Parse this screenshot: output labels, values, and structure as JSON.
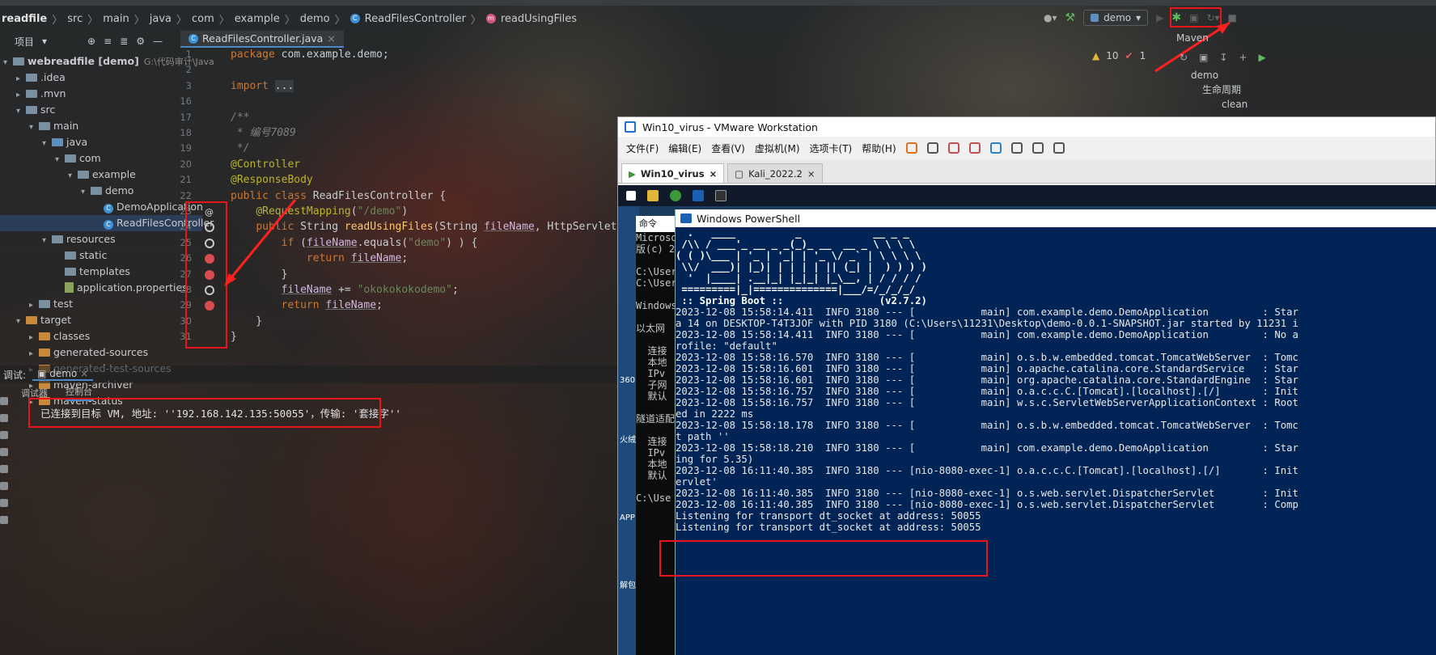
{
  "breadcrumb": [
    "readfile",
    "src",
    "main",
    "java",
    "com",
    "example",
    "demo",
    "ReadFilesController",
    "readUsingFiles"
  ],
  "project": {
    "header": "项目",
    "items": [
      {
        "label": "webreadfile [demo]",
        "extra": "G:\\代码审计\\Java",
        "indent": 0,
        "kind": "module",
        "open": true
      },
      {
        "label": ".idea",
        "indent": 1,
        "kind": "folder",
        "open": false
      },
      {
        "label": ".mvn",
        "indent": 1,
        "kind": "folder",
        "open": false
      },
      {
        "label": "src",
        "indent": 1,
        "kind": "folder",
        "open": true
      },
      {
        "label": "main",
        "indent": 2,
        "kind": "folder",
        "open": true
      },
      {
        "label": "java",
        "indent": 3,
        "kind": "bfolder",
        "open": true
      },
      {
        "label": "com",
        "indent": 4,
        "kind": "folder",
        "open": true
      },
      {
        "label": "example",
        "indent": 5,
        "kind": "folder",
        "open": true
      },
      {
        "label": "demo",
        "indent": 6,
        "kind": "folder",
        "open": true
      },
      {
        "label": "DemoApplication",
        "indent": 7,
        "kind": "class"
      },
      {
        "label": "ReadFilesController",
        "indent": 7,
        "kind": "class",
        "selected": true
      },
      {
        "label": "resources",
        "indent": 3,
        "kind": "folder",
        "open": true
      },
      {
        "label": "static",
        "indent": 4,
        "kind": "folder"
      },
      {
        "label": "templates",
        "indent": 4,
        "kind": "folder"
      },
      {
        "label": "application.properties",
        "indent": 4,
        "kind": "file"
      },
      {
        "label": "test",
        "indent": 2,
        "kind": "folder",
        "open": false
      },
      {
        "label": "target",
        "indent": 1,
        "kind": "ofolder",
        "open": true
      },
      {
        "label": "classes",
        "indent": 2,
        "kind": "ofolder",
        "open": false
      },
      {
        "label": "generated-sources",
        "indent": 2,
        "kind": "ofolder",
        "open": false
      },
      {
        "label": "generated-test-sources",
        "indent": 2,
        "kind": "ofolder",
        "open": false
      },
      {
        "label": "maven-archiver",
        "indent": 2,
        "kind": "ofolder",
        "open": false
      },
      {
        "label": "maven-status",
        "indent": 2,
        "kind": "ofolder",
        "open": false
      }
    ]
  },
  "editor": {
    "tab": "ReadFilesController.java",
    "lines": [
      {
        "n": "1",
        "html": "<span class='kw'>package</span> com.example.demo;"
      },
      {
        "n": "2",
        "html": ""
      },
      {
        "n": "3",
        "html": "<span class='kw'>import</span> <span style='background:#3a3d40'>...</span>"
      },
      {
        "n": "16",
        "html": ""
      },
      {
        "n": "17",
        "html": "<span class='cm'>/**</span>"
      },
      {
        "n": "18",
        "html": "<span class='cm'> * 编号7089</span>"
      },
      {
        "n": "19",
        "html": "<span class='cm'> */</span>"
      },
      {
        "n": "20",
        "html": "<span class='an'>@Controller</span>"
      },
      {
        "n": "21",
        "html": "<span class='an'>@ResponseBody</span>"
      },
      {
        "n": "22",
        "html": "<span class='kw'>public class</span> ReadFilesController {"
      },
      {
        "n": "23",
        "html": "    <span class='an'>@RequestMapping</span>(<span class='st'>\"/demo\"</span>)"
      },
      {
        "n": "24",
        "html": "    <span class='kw'>public</span> String <span class='fn'>readUsingFiles</span>(String <span class='vr'>fileName</span>, HttpServletRespons"
      },
      {
        "n": "25",
        "html": "        <span class='kw'>if</span> (<span class='vr'>fileName</span>.equals(<span class='st'>\"demo\"</span>) ) {"
      },
      {
        "n": "26",
        "html": "            <span class='kw'>return</span> <span class='vr'>fileName</span>;"
      },
      {
        "n": "27",
        "html": "        }"
      },
      {
        "n": "28",
        "html": "        <span class='vr'>fileName</span> += <span class='st'>\"okokokokodemo\"</span>;"
      },
      {
        "n": "29",
        "html": "        <span class='kw'>return</span> <span class='vr'>fileName</span>;"
      },
      {
        "n": "30",
        "html": "    }"
      },
      {
        "n": "31",
        "html": "}"
      }
    ],
    "warnings": "10",
    "errors": "1"
  },
  "debug": {
    "label": "调试:",
    "config": "demo",
    "tab_debugger": "调试器",
    "tab_console": "控制台",
    "message": "已连接到目标 VM, 地址: ''192.168.142.135:50055'，传输: '套接字''"
  },
  "toolbar": {
    "config": "demo"
  },
  "maven": {
    "title": "Maven",
    "items": [
      "demo",
      "生命周期",
      "clean"
    ]
  },
  "vm": {
    "title": "Win10_virus - VMware Workstation",
    "menu": [
      "文件(F)",
      "编辑(E)",
      "查看(V)",
      "虚拟机(M)",
      "选项卡(T)",
      "帮助(H)"
    ],
    "tabs": [
      "Win10_virus",
      "Kali_2022.2"
    ],
    "cmd_title": "命令",
    "cmd_lines": [
      "Microso",
      "版(c) 20",
      "",
      "C:\\User",
      "C:\\User",
      "",
      "Windows",
      "",
      "以太网",
      "",
      "  连接",
      "  本地",
      "  IPv",
      "  子网",
      "  默认",
      "",
      "隧道适配",
      "",
      "  连接",
      "  IPv",
      "  本地",
      "  默认",
      "",
      "C:\\Use"
    ],
    "desktop": [
      "360",
      "火绒",
      "APP",
      "解包"
    ],
    "ps_title": "Windows PowerShell",
    "ps_lines": [
      "  .   ____          _            __ _ _",
      " /\\\\ / ___'_ __ _ _(_)_ __  __ _ \\ \\ \\ \\",
      "( ( )\\___ | '_ | '_| | '_ \\/ _` | \\ \\ \\ \\",
      " \\\\/  ___)| |_)| | | | | || (_| |  ) ) ) )",
      "  '  |____| .__|_| |_|_| |_\\__, | / / / /",
      " =========|_|==============|___/=/_/_/_/",
      " :: Spring Boot ::                (v2.7.2)",
      "",
      "2023-12-08 15:58:14.411  INFO 3180 --- [           main] com.example.demo.DemoApplication         : Star",
      "a 14 on DESKTOP-T4T3JOF with PID 3180 (C:\\Users\\11231\\Desktop\\demo-0.0.1-SNAPSHOT.jar started by 11231 i",
      "2023-12-08 15:58:14.411  INFO 3180 --- [           main] com.example.demo.DemoApplication         : No a",
      "rofile: \"default\"",
      "2023-12-08 15:58:16.570  INFO 3180 --- [           main] o.s.b.w.embedded.tomcat.TomcatWebServer  : Tomc",
      "2023-12-08 15:58:16.601  INFO 3180 --- [           main] o.apache.catalina.core.StandardService   : Star",
      "2023-12-08 15:58:16.601  INFO 3180 --- [           main] org.apache.catalina.core.StandardEngine  : Star",
      "2023-12-08 15:58:16.757  INFO 3180 --- [           main] o.a.c.c.C.[Tomcat].[localhost].[/]       : Init",
      "",
      "2023-12-08 15:58:16.757  INFO 3180 --- [           main] w.s.c.ServletWebServerApplicationContext : Root",
      "ed in 2222 ms",
      "2023-12-08 15:58:18.178  INFO 3180 --- [           main] o.s.b.w.embedded.tomcat.TomcatWebServer  : Tomc",
      "t path ''",
      "2023-12-08 15:58:18.210  INFO 3180 --- [           main] com.example.demo.DemoApplication         : Star",
      "ing for 5.35)",
      "2023-12-08 16:11:40.385  INFO 3180 --- [nio-8080-exec-1] o.a.c.c.C.[Tomcat].[localhost].[/]       : Init",
      "ervlet'",
      "2023-12-08 16:11:40.385  INFO 3180 --- [nio-8080-exec-1] o.s.web.servlet.DispatcherServlet        : Init",
      "2023-12-08 16:11:40.385  INFO 3180 --- [nio-8080-exec-1] o.s.web.servlet.DispatcherServlet        : Comp",
      "Listening for transport dt_socket at address: 50055",
      "Listening for transport dt_socket at address: 50055"
    ]
  }
}
